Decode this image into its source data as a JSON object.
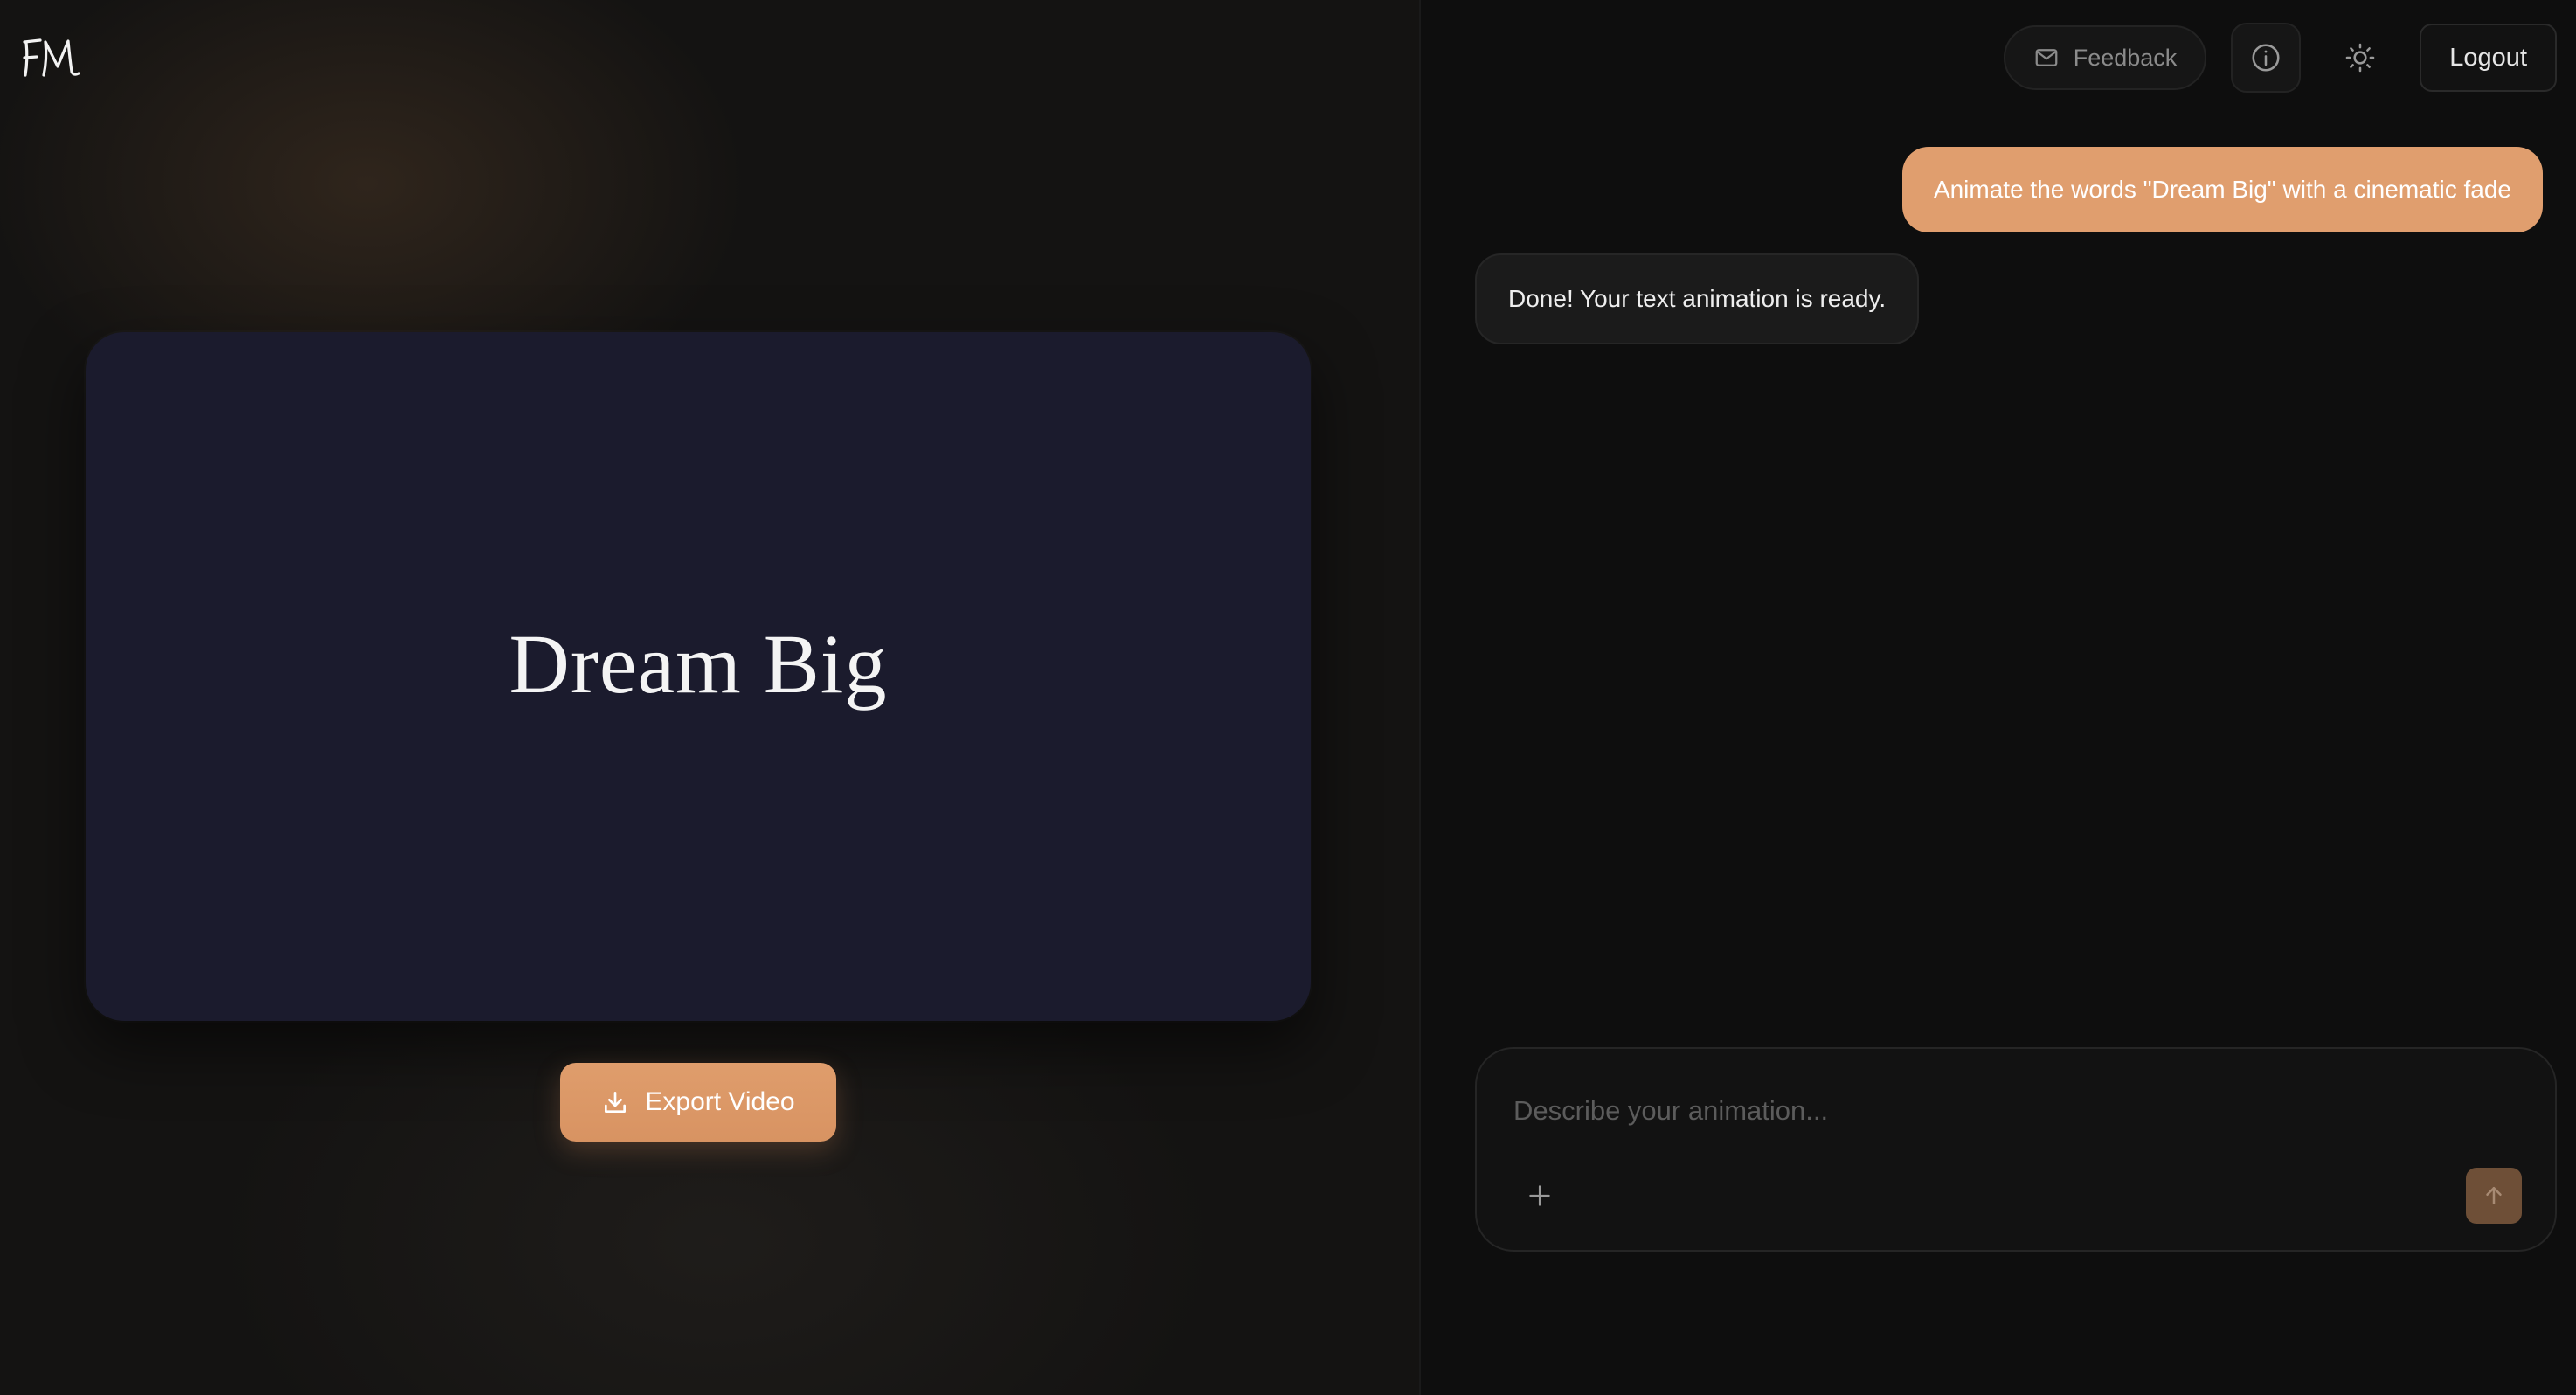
{
  "logo": {
    "text": "FM"
  },
  "preview": {
    "text": "Dream Big"
  },
  "export": {
    "label": "Export Video",
    "icon": "download-icon"
  },
  "topbar": {
    "feedback_label": "Feedback",
    "feedback_icon": "mail-icon",
    "info_icon": "info-icon",
    "theme_icon": "sun-icon",
    "logout_label": "Logout"
  },
  "messages": [
    {
      "role": "user",
      "text": "Animate the words \"Dream Big\" with a cinematic fade"
    },
    {
      "role": "assistant",
      "text": "Done! Your text animation is ready."
    }
  ],
  "composer": {
    "placeholder": "Describe your animation...",
    "value": "",
    "attach_icon": "plus-icon",
    "send_icon": "arrow-up-icon"
  },
  "colors": {
    "accent": "#e09e6e",
    "preview_bg": "#1b1b2d",
    "send_disabled": "#6e4f37"
  }
}
